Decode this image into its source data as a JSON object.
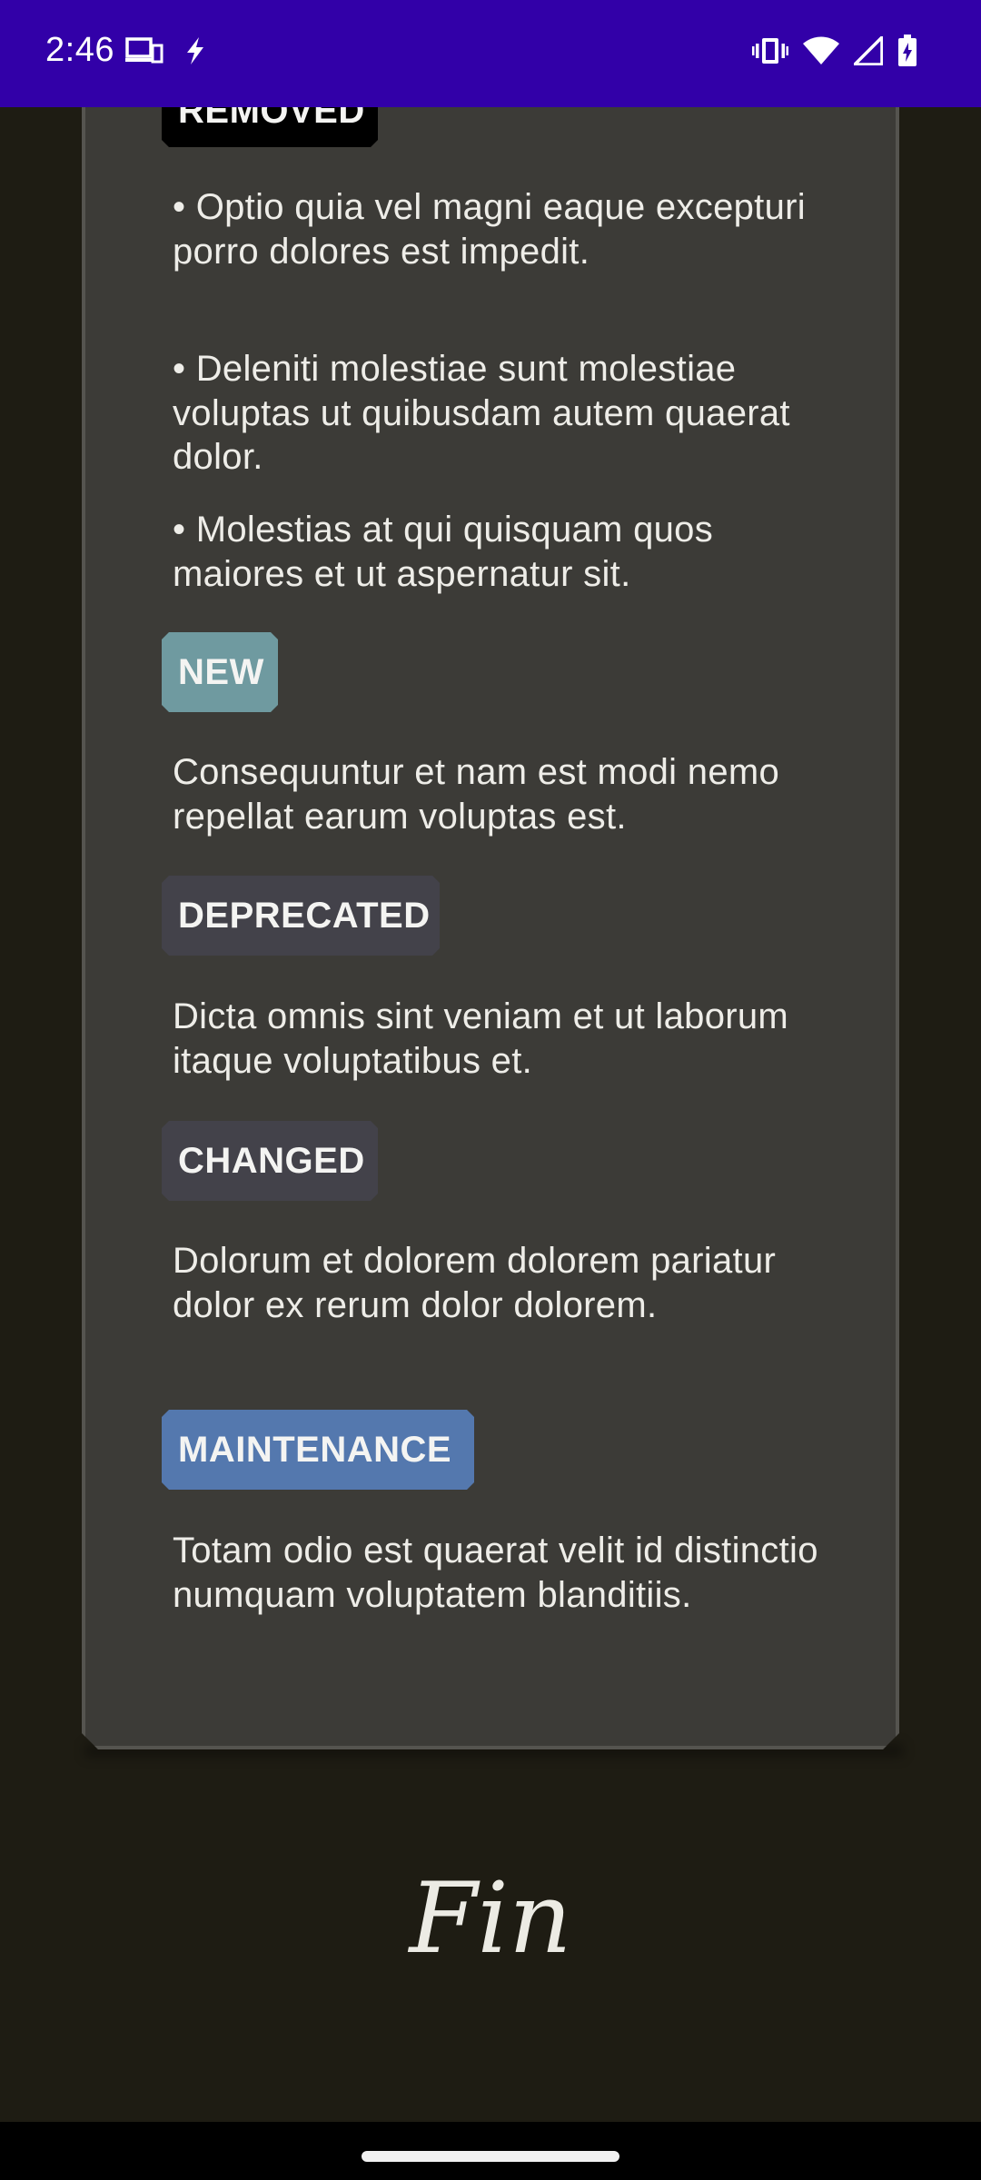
{
  "status_bar": {
    "time": "2:46",
    "left_icons": [
      "devices-icon",
      "flash-icon"
    ],
    "right_icons": [
      "vibrate-icon",
      "wifi-icon",
      "signal-icon",
      "battery-charging-icon"
    ],
    "background": "#3200a8"
  },
  "card": {
    "sections": {
      "removed": {
        "tag": "REMOVED",
        "tag_color": "#000000",
        "items": [
          "• Optio quia vel magni eaque excepturi porro dolores est impedit.",
          "• Deleniti molestiae sunt molestiae voluptas ut quibusdam autem quaerat dolor.",
          "• Molestias at qui quisquam quos maiores et ut aspernatur sit."
        ]
      },
      "new": {
        "tag": "NEW",
        "tag_color": "#6f9aa0",
        "text": "Consequuntur et nam est modi nemo repellat earum voluptas est."
      },
      "deprecated": {
        "tag": "DEPRECATED",
        "tag_color": "#43424a",
        "text": "Dicta omnis sint veniam et ut laborum itaque voluptatibus et."
      },
      "changed": {
        "tag": "CHANGED",
        "tag_color": "#43424a",
        "text": "Dolorum et dolorem dolorem pariatur dolor ex rerum dolor dolorem."
      },
      "maintenance": {
        "tag": "MAINTENANCE",
        "tag_color": "#5478ae",
        "text": "Totam odio est quaerat velit id distinctio numquam voluptatem blanditiis."
      }
    }
  },
  "footer": {
    "fin": "Fin"
  },
  "theme": {
    "background": "#1e1c13",
    "card_background": "#3c3b37"
  }
}
